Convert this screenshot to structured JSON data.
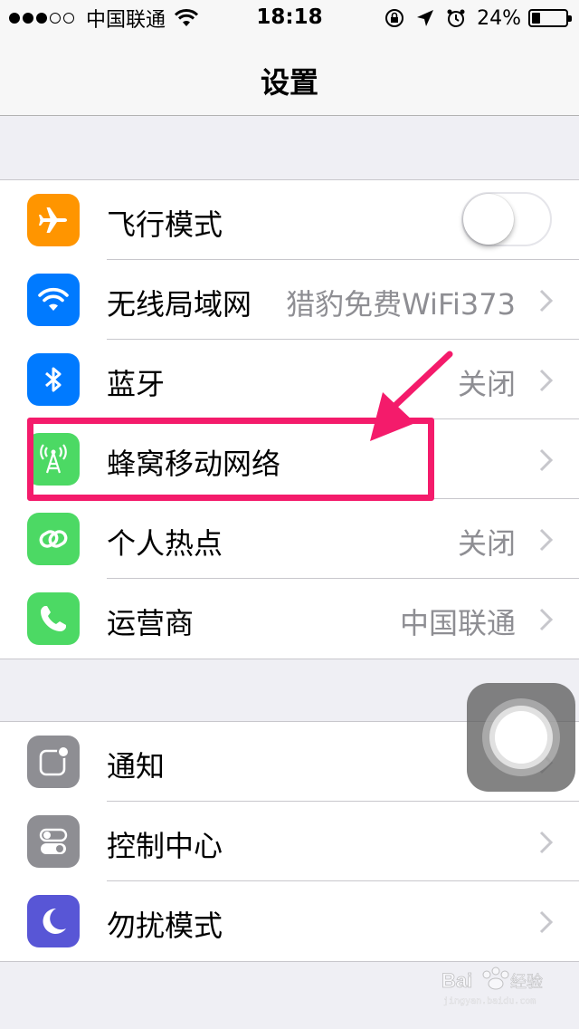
{
  "status_bar": {
    "carrier": "中国联通",
    "time": "18:18",
    "battery_percent": "24%",
    "signal_bars_filled": 3,
    "signal_bars_total": 5,
    "battery_level": 0.24
  },
  "nav": {
    "title": "设置"
  },
  "group1": {
    "rows": [
      {
        "label": "飞行模式",
        "icon": "airplane-icon",
        "color": "#ff9500",
        "toggle_on": false
      },
      {
        "label": "无线局域网",
        "icon": "wifi-icon",
        "color": "#007aff",
        "value": "猎豹免费WiFi373"
      },
      {
        "label": "蓝牙",
        "icon": "bluetooth-icon",
        "color": "#007aff",
        "value": "关闭"
      },
      {
        "label": "蜂窝移动网络",
        "icon": "cellular-icon",
        "color": "#4cd964"
      },
      {
        "label": "个人热点",
        "icon": "hotspot-icon",
        "color": "#4cd964",
        "value": "关闭"
      },
      {
        "label": "运营商",
        "icon": "phone-icon",
        "color": "#4cd964",
        "value": "中国联通"
      }
    ]
  },
  "group2": {
    "rows": [
      {
        "label": "通知",
        "icon": "notifications-icon",
        "color": "#8e8e93"
      },
      {
        "label": "控制中心",
        "icon": "control-center-icon",
        "color": "#8e8e93"
      },
      {
        "label": "勿扰模式",
        "icon": "moon-icon",
        "color": "#5856d6"
      }
    ]
  },
  "annotation": {
    "highlight_color": "#f41b6b"
  },
  "watermark": {
    "text": "Bai经验"
  }
}
